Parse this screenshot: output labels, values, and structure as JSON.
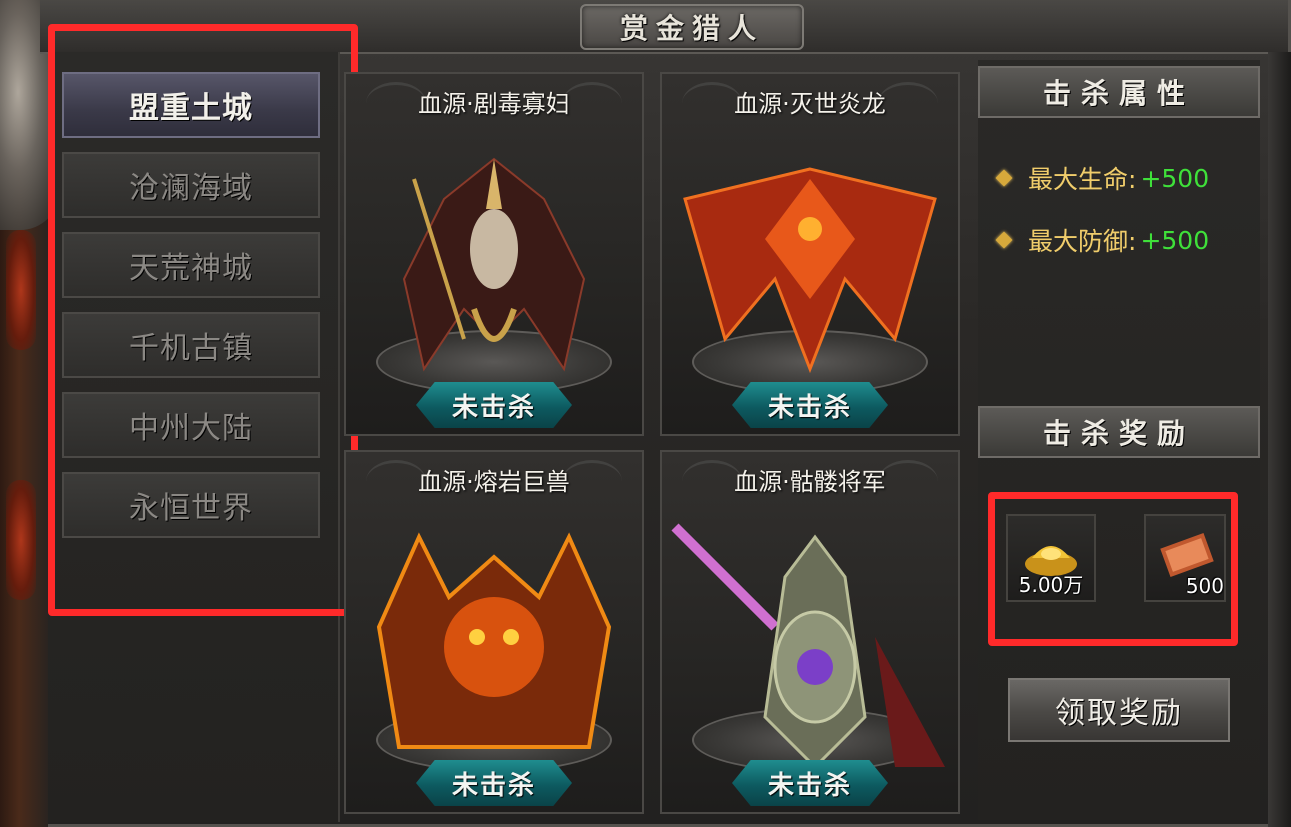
{
  "window": {
    "title": "赏金猎人"
  },
  "sidebar": {
    "items": [
      {
        "label": "盟重土城",
        "active": true
      },
      {
        "label": "沧澜海域",
        "active": false
      },
      {
        "label": "天荒神城",
        "active": false
      },
      {
        "label": "千机古镇",
        "active": false
      },
      {
        "label": "中州大陆",
        "active": false
      },
      {
        "label": "永恒世界",
        "active": false
      }
    ]
  },
  "bosses": [
    {
      "name": "血源·剧毒寡妇",
      "status": "未击杀",
      "icon": "poison-widow-icon",
      "color": "#7a2a22"
    },
    {
      "name": "血源·灭世炎龙",
      "status": "未击杀",
      "icon": "fire-dragon-icon",
      "color": "#e0461a"
    },
    {
      "name": "血源·熔岩巨兽",
      "status": "未击杀",
      "icon": "lava-beast-icon",
      "color": "#f07a12"
    },
    {
      "name": "血源·骷髅将军",
      "status": "未击杀",
      "icon": "skeleton-general-icon",
      "color": "#9aa07e"
    }
  ],
  "kill_attributes": {
    "heading": "击杀属性",
    "items": [
      {
        "name": "最大生命:",
        "value": "+500"
      },
      {
        "name": "最大防御:",
        "value": "+500"
      }
    ]
  },
  "kill_rewards": {
    "heading": "击杀奖励",
    "items": [
      {
        "icon": "gold-ingot-icon",
        "qty": "5.00万"
      },
      {
        "icon": "scroll-book-icon",
        "qty": "500"
      }
    ]
  },
  "claim_button": {
    "label": "领取奖励"
  },
  "colors": {
    "status_teal": "#0d5a60",
    "attr_gold": "#f0cd6b",
    "attr_green": "#3fe03a",
    "highlight_red": "#ff2a2a"
  }
}
